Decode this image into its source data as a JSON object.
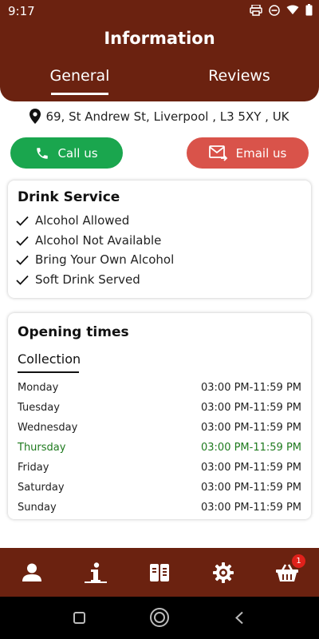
{
  "status_bar": {
    "time": "9:17"
  },
  "header": {
    "title": "Information",
    "tabs": [
      {
        "label": "General",
        "active": true
      },
      {
        "label": "Reviews",
        "active": false
      }
    ]
  },
  "address": "69, St Andrew St, Liverpool , L3 5XY , UK",
  "actions": {
    "call_label": "Call us",
    "email_label": "Email us"
  },
  "drink_service": {
    "title": "Drink Service",
    "items": [
      "Alcohol Allowed",
      "Alcohol Not Available",
      "Bring Your Own Alcohol",
      "Soft Drink Served"
    ]
  },
  "opening_times": {
    "title": "Opening times",
    "section": "Collection",
    "rows": [
      {
        "day": "Monday",
        "time": "03:00 PM-11:59 PM"
      },
      {
        "day": "Tuesday",
        "time": "03:00 PM-11:59 PM"
      },
      {
        "day": "Wednesday",
        "time": "03:00 PM-11:59 PM"
      },
      {
        "day": "Thursday",
        "time": "03:00 PM-11:59 PM",
        "today": true
      },
      {
        "day": "Friday",
        "time": "03:00 PM-11:59 PM"
      },
      {
        "day": "Saturday",
        "time": "03:00 PM-11:59 PM"
      },
      {
        "day": "Sunday",
        "time": "03:00 PM-11:59 PM"
      }
    ]
  },
  "bottom_nav": {
    "items": [
      "user-icon",
      "info-icon",
      "menu-book-icon",
      "settings-gear-icon",
      "basket-icon"
    ],
    "active": "info-icon",
    "cart_count": "1"
  },
  "colors": {
    "brand": "#6b2210",
    "call": "#1aa64e",
    "email": "#d9534a",
    "today": "#1e7a1e",
    "badge": "#e0211b"
  }
}
